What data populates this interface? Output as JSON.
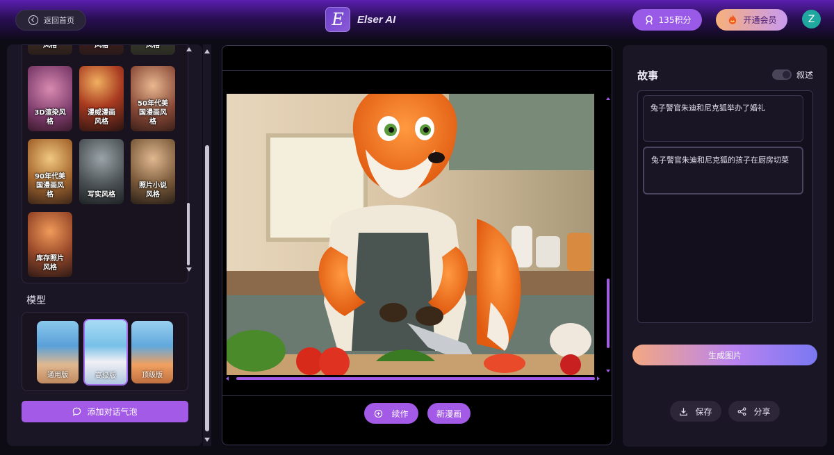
{
  "header": {
    "back_label": "返回首页",
    "brand_letter": "E",
    "brand_name": "Elser AI",
    "points_label": "135积分",
    "member_label": "开通会员",
    "avatar_letter": "Z"
  },
  "styles": {
    "items": [
      {
        "label": "风格"
      },
      {
        "label": "风格"
      },
      {
        "label": "风格"
      },
      {
        "label": "3D渲染风格"
      },
      {
        "label": "漫威漫画风格"
      },
      {
        "label": "50年代美国漫画风格"
      },
      {
        "label": "90年代美国漫画风格"
      },
      {
        "label": "写实风格"
      },
      {
        "label": "照片小说风格"
      },
      {
        "label": "库存照片风格"
      }
    ]
  },
  "model": {
    "title": "模型",
    "options": [
      {
        "label": "通用版",
        "selected": false
      },
      {
        "label": "高级版",
        "selected": true
      },
      {
        "label": "顶级版",
        "selected": false
      }
    ]
  },
  "bubble_button": "添加对话气泡",
  "canvas": {
    "continue_label": "续作",
    "new_comic_label": "新漫画"
  },
  "story": {
    "title": "故事",
    "narrate_label": "叙述",
    "items": [
      "兔子警官朱迪和尼克狐举办了婚礼",
      "兔子警官朱迪和尼克狐的孩子在厨房切菜"
    ],
    "generate_label": "生成图片",
    "save_label": "保存",
    "share_label": "分享"
  },
  "colors": {
    "accent": "#a35ae6",
    "points": "#9a5ae8",
    "avatar": "#1fa7a0"
  },
  "icons": [
    "back-arrow-icon",
    "brand-logo",
    "points-icon",
    "crown-fire-icon",
    "chat-bubble-icon",
    "plus-circle-icon",
    "download-icon",
    "share-icon"
  ]
}
